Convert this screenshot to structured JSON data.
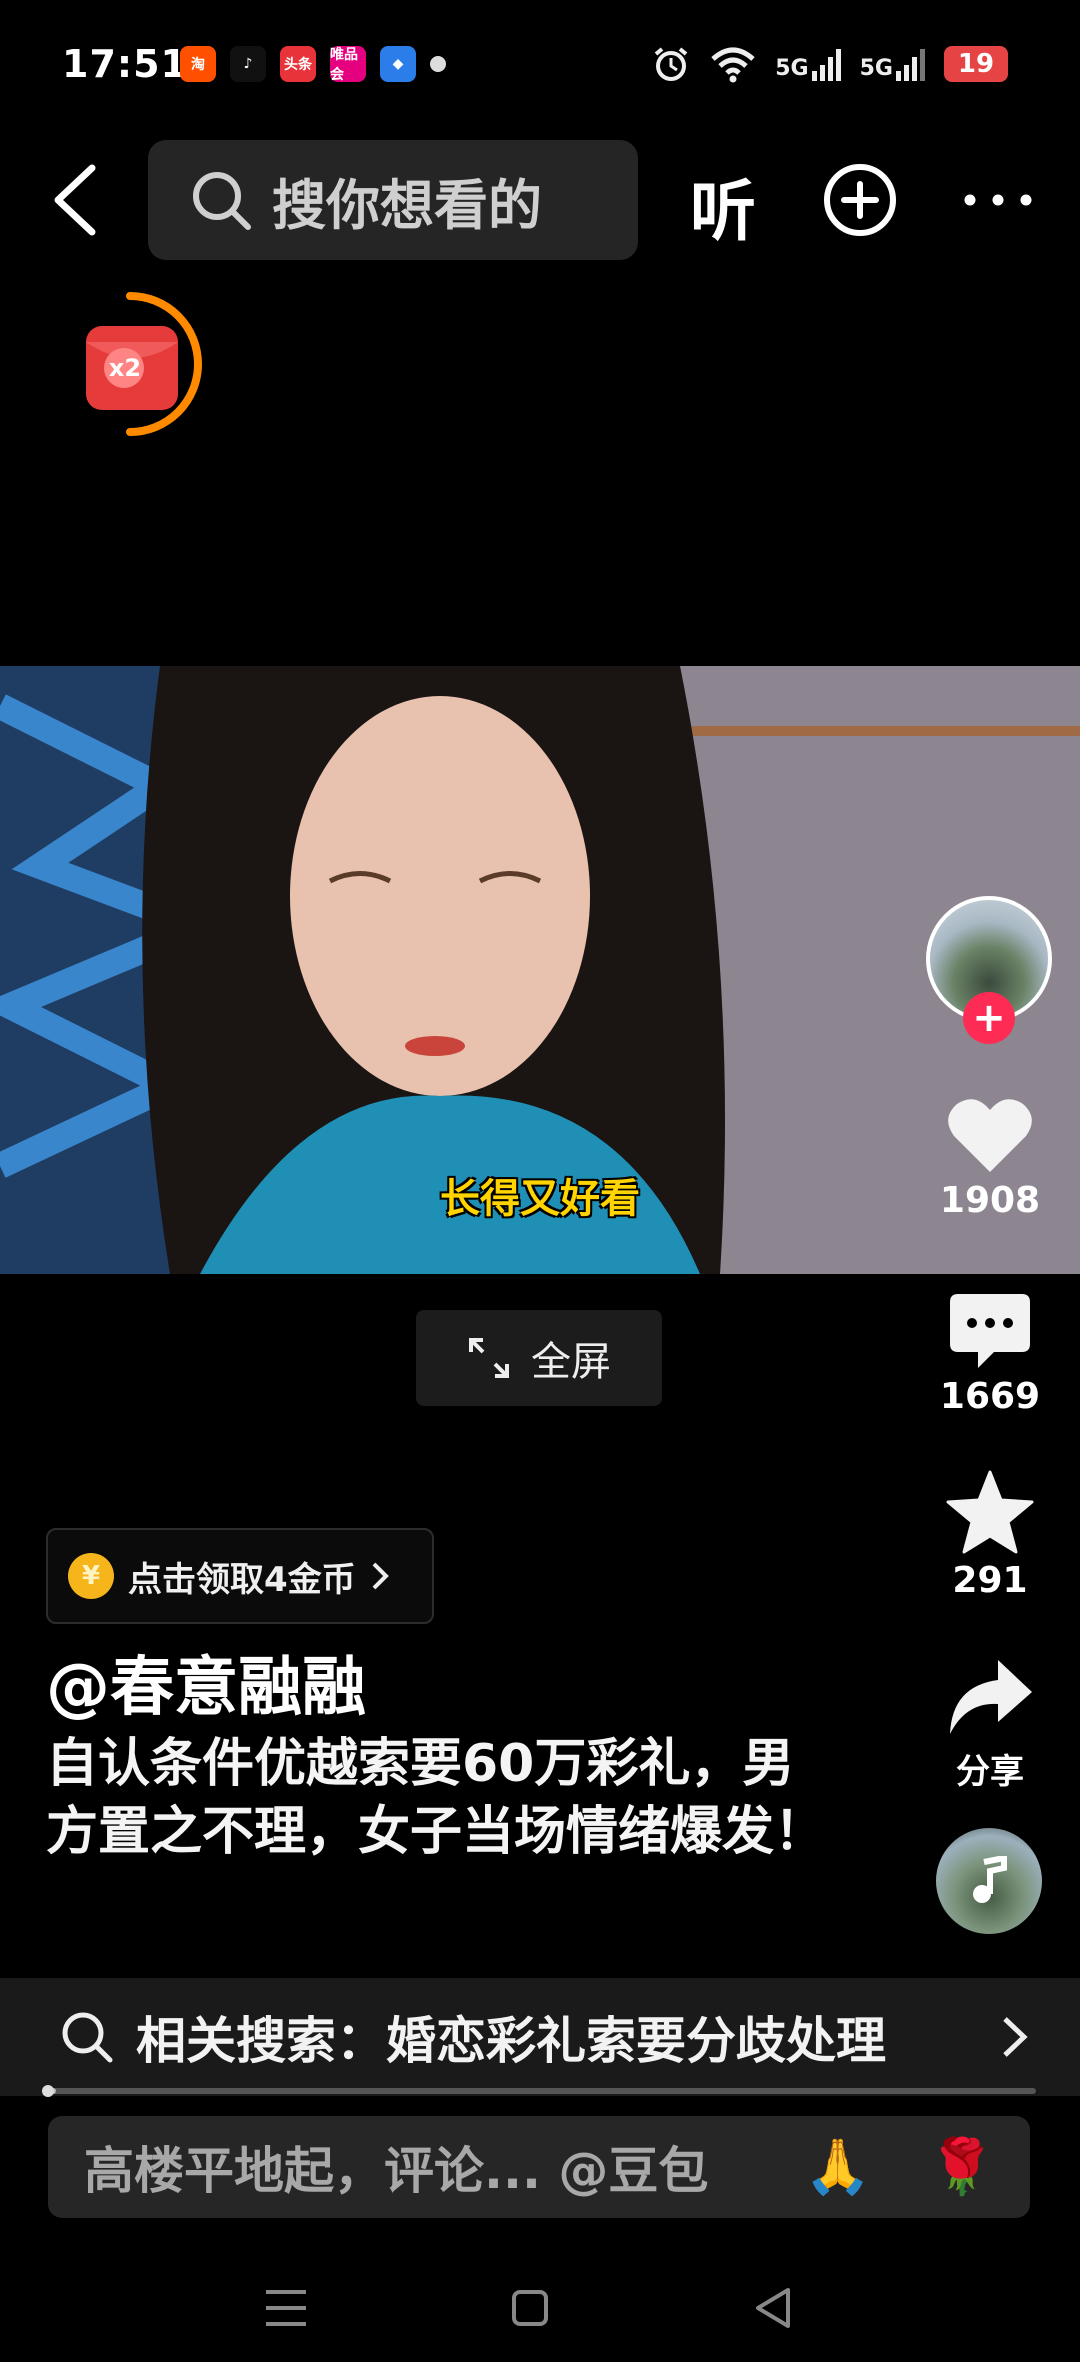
{
  "status": {
    "time": "17:51",
    "app_icons": [
      {
        "name": "taobao-app-icon",
        "label": "淘",
        "color": "#ff5000"
      },
      {
        "name": "tiktok-app-icon",
        "label": "♪",
        "color": "#111111"
      },
      {
        "name": "toutiao-app-icon",
        "label": "头条",
        "color": "#e8333a"
      },
      {
        "name": "vip-app-icon",
        "label": "唯品会",
        "color": "#e4007f"
      },
      {
        "name": "browser-app-icon",
        "label": "◆",
        "color": "#2b7de9"
      }
    ],
    "signal_1": "5G",
    "signal_2": "5G",
    "battery": "19"
  },
  "top_nav": {
    "search_placeholder": "搜你想看的",
    "listen_label": "听"
  },
  "redpack": {
    "multiplier": "x2",
    "ring_color": "#ff8a00"
  },
  "video": {
    "subtitle": "长得又好看",
    "fullscreen_label": "全屏"
  },
  "actions": {
    "likes": "1908",
    "comments": "1669",
    "favorites": "291",
    "share_label": "分享",
    "follow_color": "#fe2c55"
  },
  "info": {
    "coin_text": "点击领取4金币",
    "coin_symbol": "¥",
    "author": "@春意融融",
    "caption": "自认条件优越索要60万彩礼，男方置之不理，女子当场情绪爆发！"
  },
  "related_search": {
    "text": "相关搜索：婚恋彩礼索要分歧处理"
  },
  "comment_bar": {
    "placeholder": "高楼平地起，评论... @豆包",
    "emoji_1": "🙏",
    "emoji_2": "🌹"
  },
  "progress": {
    "fraction": 0.01
  }
}
